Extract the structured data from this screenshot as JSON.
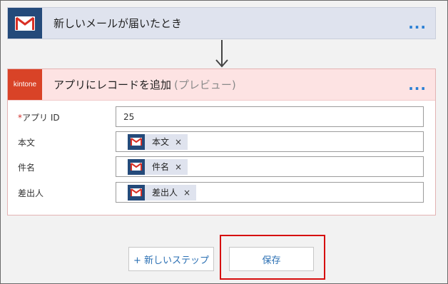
{
  "trigger": {
    "icon": "gmail-icon",
    "title": "新しいメールが届いたとき",
    "more": "..."
  },
  "action": {
    "icon_text": "kintone",
    "title": "アプリにレコードを追加",
    "preview": "(プレビュー)",
    "more": "..."
  },
  "fields": [
    {
      "required_mark": "*",
      "label": "アプリ ID",
      "value": "25"
    },
    {
      "label": "本文",
      "token": "本文",
      "close": "×"
    },
    {
      "label": "件名",
      "token": "件名",
      "close": "×"
    },
    {
      "label": "差出人",
      "token": "差出人",
      "close": "×"
    }
  ],
  "buttons": {
    "new_step": "+ 新しいステップ",
    "save": "保存"
  },
  "colors": {
    "gmail_badge": "#244a7a",
    "kintone_badge": "#d94327",
    "link_blue": "#2a7fd4",
    "highlight_red": "#d60d0d"
  }
}
